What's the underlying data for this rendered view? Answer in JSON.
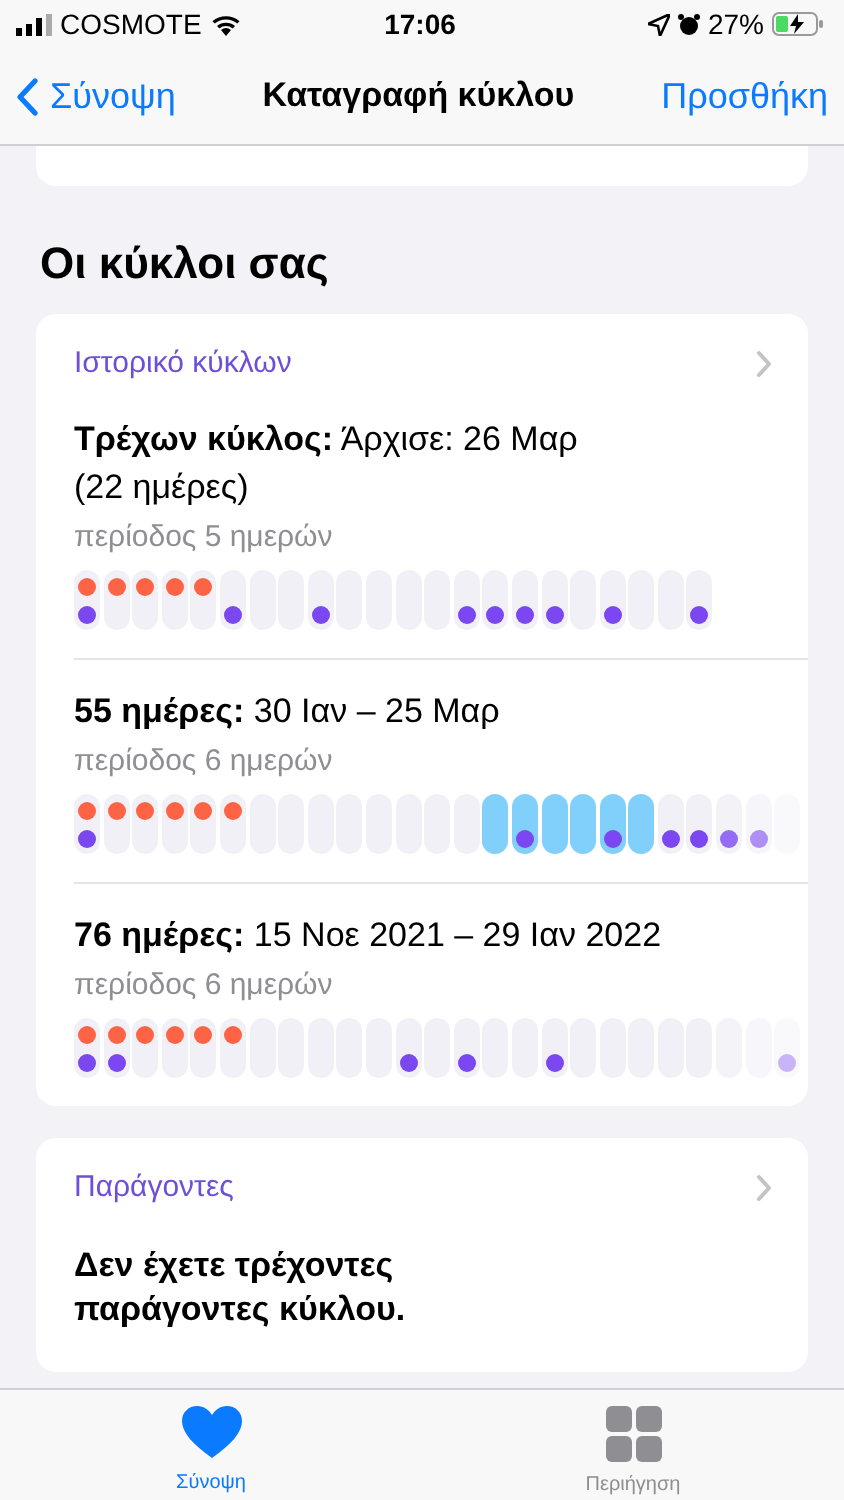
{
  "status_bar": {
    "carrier": "COSMOTE",
    "time": "17:06",
    "battery": "27%",
    "charging": true
  },
  "nav": {
    "back": "Σύνοψη",
    "title": "Καταγραφή κύκλου",
    "action": "Προσθήκη"
  },
  "section_title": "Οι κύκλοι σας",
  "history": {
    "title": "Ιστορικό κύκλων",
    "cycles": [
      {
        "label": "Τρέχων κύκλος:",
        "dates": "Άρχισε: 26 Μαρ (22 ημέρες)",
        "period": "περίοδος 5 ημερών",
        "days": [
          {
            "period": true,
            "symptom": true,
            "fertile": false
          },
          {
            "period": true,
            "symptom": false,
            "fertile": false
          },
          {
            "period": true,
            "symptom": false,
            "fertile": false
          },
          {
            "period": true,
            "symptom": false,
            "fertile": false
          },
          {
            "period": true,
            "symptom": false,
            "fertile": false
          },
          {
            "period": false,
            "symptom": true,
            "fertile": false
          },
          {
            "period": false,
            "symptom": false,
            "fertile": false
          },
          {
            "period": false,
            "symptom": false,
            "fertile": false
          },
          {
            "period": false,
            "symptom": true,
            "fertile": false
          },
          {
            "period": false,
            "symptom": false,
            "fertile": false
          },
          {
            "period": false,
            "symptom": false,
            "fertile": false
          },
          {
            "period": false,
            "symptom": false,
            "fertile": false
          },
          {
            "period": false,
            "symptom": false,
            "fertile": false
          },
          {
            "period": false,
            "symptom": true,
            "fertile": false
          },
          {
            "period": false,
            "symptom": true,
            "fertile": false
          },
          {
            "period": false,
            "symptom": true,
            "fertile": false
          },
          {
            "period": false,
            "symptom": true,
            "fertile": false
          },
          {
            "period": false,
            "symptom": false,
            "fertile": false
          },
          {
            "period": false,
            "symptom": true,
            "fertile": false
          },
          {
            "period": false,
            "symptom": false,
            "fertile": false
          },
          {
            "period": false,
            "symptom": false,
            "fertile": false
          },
          {
            "period": false,
            "symptom": true,
            "fertile": false
          }
        ]
      },
      {
        "label": "55 ημέρες:",
        "dates": "30 Ιαν – 25 Μαρ",
        "period": "περίοδος 6 ημερών",
        "days": [
          {
            "period": true,
            "symptom": true,
            "fertile": false
          },
          {
            "period": true,
            "symptom": false,
            "fertile": false
          },
          {
            "period": true,
            "symptom": false,
            "fertile": false
          },
          {
            "period": true,
            "symptom": false,
            "fertile": false
          },
          {
            "period": true,
            "symptom": false,
            "fertile": false
          },
          {
            "period": true,
            "symptom": false,
            "fertile": false
          },
          {
            "period": false,
            "symptom": false,
            "fertile": false
          },
          {
            "period": false,
            "symptom": false,
            "fertile": false
          },
          {
            "period": false,
            "symptom": false,
            "fertile": false
          },
          {
            "period": false,
            "symptom": false,
            "fertile": false
          },
          {
            "period": false,
            "symptom": false,
            "fertile": false
          },
          {
            "period": false,
            "symptom": false,
            "fertile": false
          },
          {
            "period": false,
            "symptom": false,
            "fertile": false
          },
          {
            "period": false,
            "symptom": false,
            "fertile": false
          },
          {
            "period": false,
            "symptom": false,
            "fertile": true
          },
          {
            "period": false,
            "symptom": true,
            "fertile": true
          },
          {
            "period": false,
            "symptom": false,
            "fertile": true
          },
          {
            "period": false,
            "symptom": false,
            "fertile": true
          },
          {
            "period": false,
            "symptom": true,
            "fertile": true
          },
          {
            "period": false,
            "symptom": false,
            "fertile": true
          },
          {
            "period": false,
            "symptom": true,
            "fertile": false
          },
          {
            "period": false,
            "symptom": true,
            "fertile": false
          },
          {
            "period": false,
            "symptom": true,
            "fertile": false
          },
          {
            "period": false,
            "symptom": true,
            "fertile": false
          },
          {
            "period": false,
            "symptom": false,
            "fertile": false
          }
        ]
      },
      {
        "label": "76 ημέρες:",
        "dates": "15 Νοε 2021 – 29 Ιαν 2022",
        "period": "περίοδος 6 ημερών",
        "days": [
          {
            "period": true,
            "symptom": true,
            "fertile": false
          },
          {
            "period": true,
            "symptom": true,
            "fertile": false
          },
          {
            "period": true,
            "symptom": false,
            "fertile": false
          },
          {
            "period": true,
            "symptom": false,
            "fertile": false
          },
          {
            "period": true,
            "symptom": false,
            "fertile": false
          },
          {
            "period": true,
            "symptom": false,
            "fertile": false
          },
          {
            "period": false,
            "symptom": false,
            "fertile": false
          },
          {
            "period": false,
            "symptom": false,
            "fertile": false
          },
          {
            "period": false,
            "symptom": false,
            "fertile": false
          },
          {
            "period": false,
            "symptom": false,
            "fertile": false
          },
          {
            "period": false,
            "symptom": false,
            "fertile": false
          },
          {
            "period": false,
            "symptom": true,
            "fertile": false
          },
          {
            "period": false,
            "symptom": false,
            "fertile": false
          },
          {
            "period": false,
            "symptom": true,
            "fertile": false
          },
          {
            "period": false,
            "symptom": false,
            "fertile": false
          },
          {
            "period": false,
            "symptom": false,
            "fertile": false
          },
          {
            "period": false,
            "symptom": true,
            "fertile": false
          },
          {
            "period": false,
            "symptom": false,
            "fertile": false
          },
          {
            "period": false,
            "symptom": false,
            "fertile": false
          },
          {
            "period": false,
            "symptom": false,
            "fertile": false
          },
          {
            "period": false,
            "symptom": false,
            "fertile": false
          },
          {
            "period": false,
            "symptom": false,
            "fertile": false
          },
          {
            "period": false,
            "symptom": false,
            "fertile": false
          },
          {
            "period": false,
            "symptom": false,
            "fertile": false
          },
          {
            "period": false,
            "symptom": true,
            "fertile": false
          }
        ]
      }
    ]
  },
  "factors": {
    "title": "Παράγοντες",
    "text": "Δεν έχετε τρέχοντες παράγοντες κύκλου."
  },
  "tabs": [
    {
      "label": "Σύνοψη",
      "selected": true,
      "kind": "heart"
    },
    {
      "label": "Περιήγηση",
      "selected": false,
      "kind": "grid"
    }
  ]
}
